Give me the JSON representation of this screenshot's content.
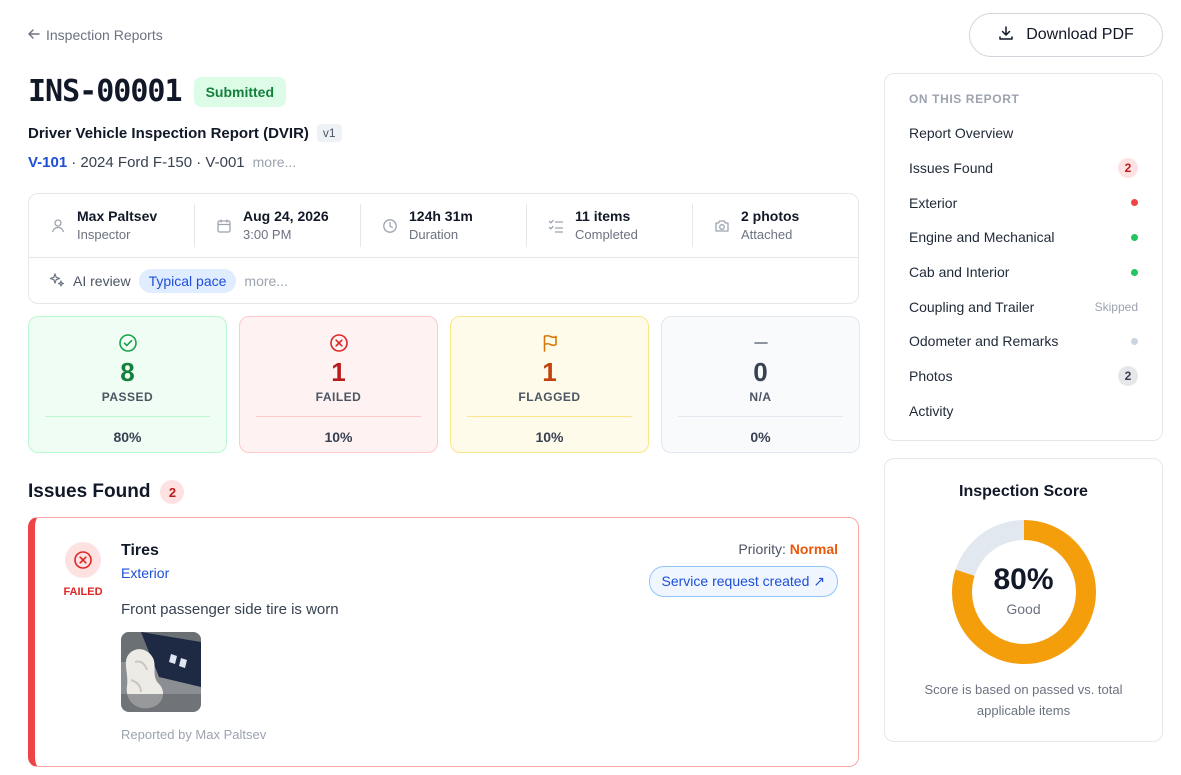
{
  "nav": {
    "back_label": "Inspection Reports"
  },
  "actions": {
    "download_label": "Download PDF"
  },
  "report": {
    "id": "INS-00001",
    "status": "Submitted",
    "template": "Driver Vehicle Inspection Report (DVIR)",
    "version": "v1",
    "vehicle_id": "V-101",
    "vehicle_desc": "· 2024 Ford F-150 · V-001",
    "vehicle_more": "more..."
  },
  "meta": {
    "inspector": {
      "main": "Max Paltsev",
      "sub": "Inspector"
    },
    "date": {
      "main": "Aug 24, 2026",
      "sub": "3:00 PM"
    },
    "duration": {
      "main": "124h 31m",
      "sub": "Duration"
    },
    "items": {
      "main": "11 items",
      "sub": "Completed"
    },
    "photos": {
      "main": "2 photos",
      "sub": "Attached"
    },
    "ai_label": "AI review",
    "ai_pill": "Typical pace",
    "ai_more": "more..."
  },
  "stats": [
    {
      "value": "8",
      "label": "PASSED",
      "pct": "80%",
      "color": "#15803d"
    },
    {
      "value": "1",
      "label": "FAILED",
      "pct": "10%",
      "color": "#b91c1c"
    },
    {
      "value": "1",
      "label": "FLAGGED",
      "pct": "10%",
      "color": "#c2410c"
    },
    {
      "value": "0",
      "label": "N/A",
      "pct": "0%",
      "color": "#374151"
    }
  ],
  "issues": {
    "title": "Issues Found",
    "count": "2",
    "items": [
      {
        "status": "FAILED",
        "name": "Tires",
        "section": "Exterior",
        "priority_label": "Priority:",
        "priority": "Normal",
        "service_label": "Service request created ↗",
        "description": "Front passenger side tire is worn",
        "reported_by": "Reported by Max Paltsev"
      }
    ]
  },
  "toc": {
    "heading": "ON THIS REPORT",
    "items": [
      {
        "label": "Report Overview"
      },
      {
        "label": "Issues Found",
        "badge": "2"
      },
      {
        "label": "Exterior",
        "dot": "#ef4444"
      },
      {
        "label": "Engine and Mechanical",
        "dot": "#22c55e"
      },
      {
        "label": "Cab and Interior",
        "dot": "#22c55e"
      },
      {
        "label": "Coupling and Trailer",
        "note": "Skipped"
      },
      {
        "label": "Odometer and Remarks",
        "dot": "#cbd5e1"
      },
      {
        "label": "Photos",
        "badge": "2"
      },
      {
        "label": "Activity"
      }
    ]
  },
  "score": {
    "title": "Inspection Score",
    "value": "80%",
    "fraction": 0.8,
    "word": "Good",
    "note": "Score is based on passed vs. total applicable items",
    "color": "#f59e0b",
    "track": "#e2e8f0"
  }
}
